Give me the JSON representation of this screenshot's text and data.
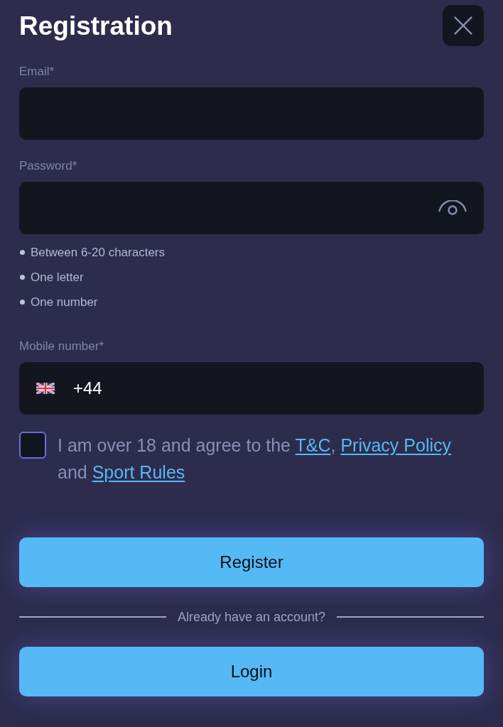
{
  "header": {
    "title": "Registration"
  },
  "fields": [
    {
      "kind": "text",
      "label": "Email*"
    },
    {
      "kind": "password",
      "label": "Password*",
      "requirements": [
        "Between 6-20 characters",
        "One letter",
        "One number"
      ]
    },
    {
      "kind": "phone",
      "label": "Mobile number*",
      "value": "+44"
    }
  ],
  "agreement": {
    "checked": false,
    "parts": [
      {
        "kind": "text",
        "text": "I am over 18 and agree to the "
      },
      {
        "kind": "link",
        "text": "T&C"
      },
      {
        "kind": "text",
        "text": ", "
      },
      {
        "kind": "link",
        "text": "Privacy Policy"
      },
      {
        "kind": "text",
        "text": " and "
      },
      {
        "kind": "link",
        "text": "Sport Rules"
      }
    ]
  },
  "actions": {
    "register": "Register",
    "divider": "Already have an account?",
    "login": "Login"
  }
}
